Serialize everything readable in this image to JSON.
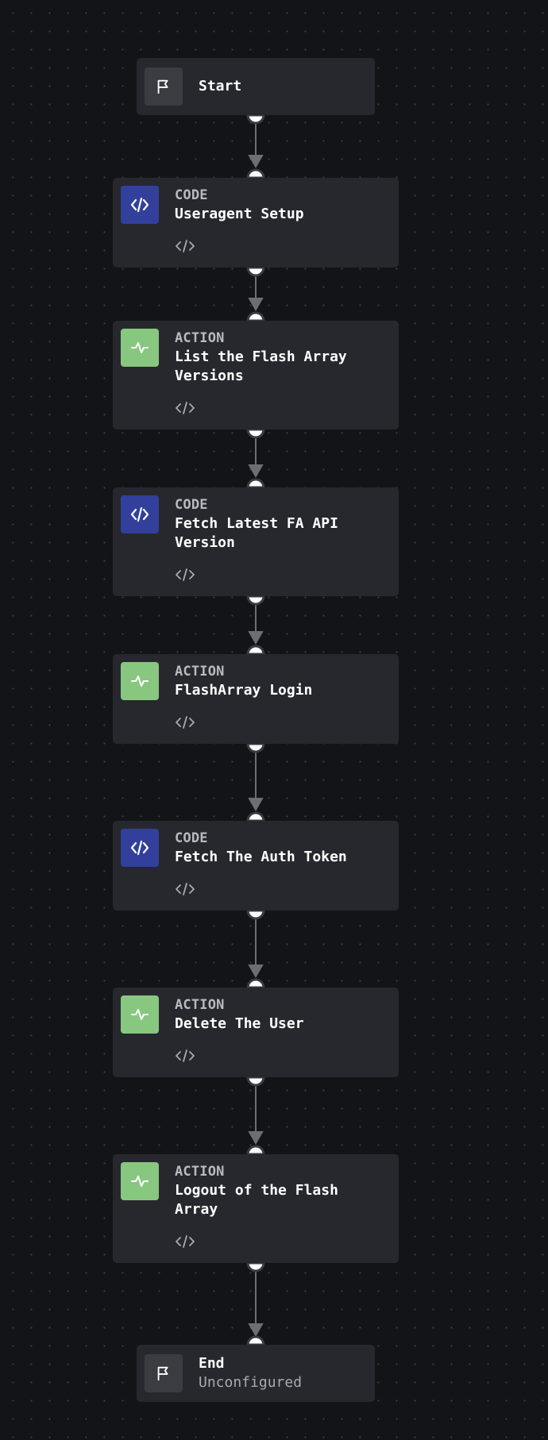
{
  "workflow": {
    "start": {
      "title": "Start",
      "icon": "flag-icon"
    },
    "steps": [
      {
        "type": "CODE",
        "title": "Useragent Setup",
        "icon": "code-icon",
        "color": "#32409c"
      },
      {
        "type": "ACTION",
        "title": "List the Flash Array Versions",
        "icon": "activity-icon",
        "color": "#88c77f"
      },
      {
        "type": "CODE",
        "title": "Fetch Latest FA API Version",
        "icon": "code-icon",
        "color": "#32409c"
      },
      {
        "type": "ACTION",
        "title": "FlashArray Login",
        "icon": "activity-icon",
        "color": "#88c77f"
      },
      {
        "type": "CODE",
        "title": "Fetch The Auth Token",
        "icon": "code-icon",
        "color": "#32409c"
      },
      {
        "type": "ACTION",
        "title": "Delete The User",
        "icon": "activity-icon",
        "color": "#88c77f"
      },
      {
        "type": "ACTION",
        "title": "Logout of the Flash Array",
        "icon": "activity-icon",
        "color": "#88c77f"
      }
    ],
    "end": {
      "title": "End",
      "status": "Unconfigured",
      "icon": "flag-icon"
    }
  },
  "theme": {
    "background": "#131417",
    "node": "#27282d",
    "code_accent": "#32409c",
    "action_accent": "#88c77f"
  }
}
